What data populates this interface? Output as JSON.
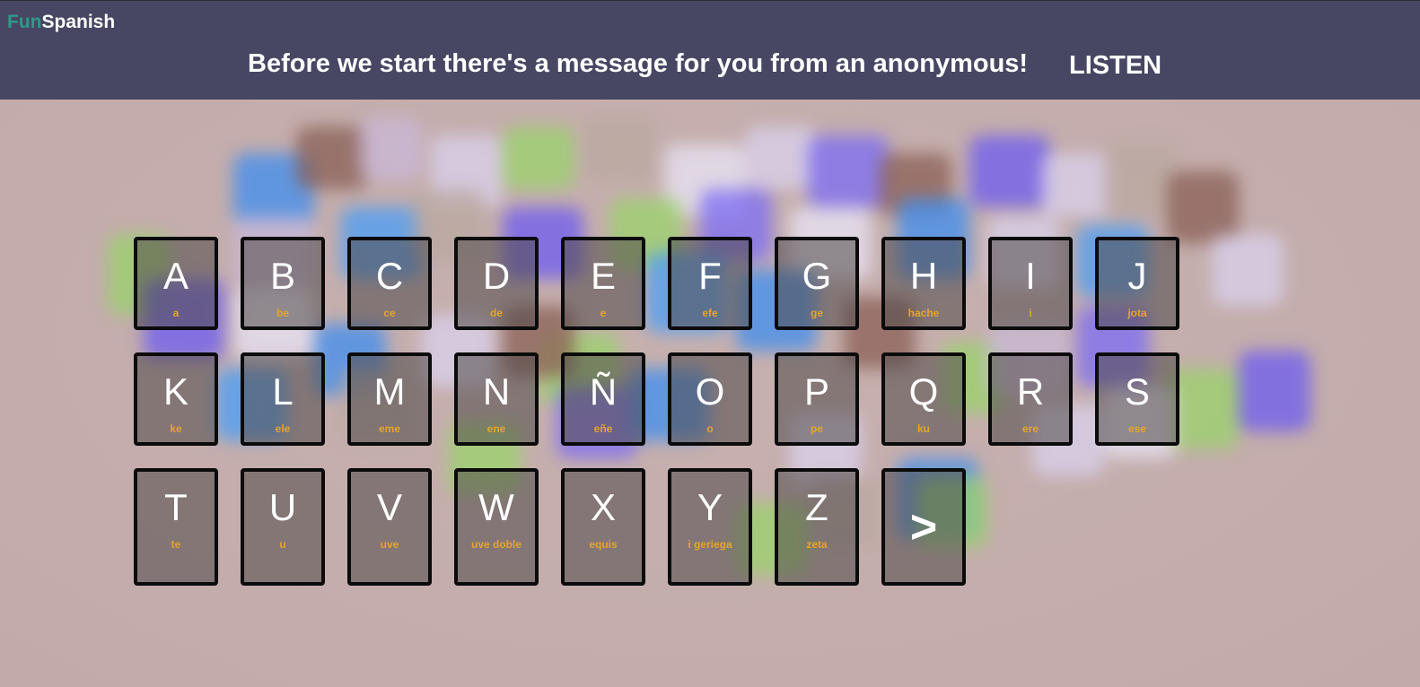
{
  "logo": {
    "part1": "Fun",
    "part2": "Spanish"
  },
  "header": {
    "message": "Before we start there's a message for you from an anonymous!",
    "listen_label": "LISTEN"
  },
  "alphabet": [
    {
      "letter": "A",
      "name": "a"
    },
    {
      "letter": "B",
      "name": "be"
    },
    {
      "letter": "C",
      "name": "ce"
    },
    {
      "letter": "D",
      "name": "de"
    },
    {
      "letter": "E",
      "name": "e"
    },
    {
      "letter": "F",
      "name": "efe"
    },
    {
      "letter": "G",
      "name": "ge"
    },
    {
      "letter": "H",
      "name": "hache"
    },
    {
      "letter": "I",
      "name": "i"
    },
    {
      "letter": "J",
      "name": "jota"
    },
    {
      "letter": "K",
      "name": "ke"
    },
    {
      "letter": "L",
      "name": "ele"
    },
    {
      "letter": "M",
      "name": "eme"
    },
    {
      "letter": "N",
      "name": "ene"
    },
    {
      "letter": "Ñ",
      "name": "eñe"
    },
    {
      "letter": "O",
      "name": "o"
    },
    {
      "letter": "P",
      "name": "pe"
    },
    {
      "letter": "Q",
      "name": "ku"
    },
    {
      "letter": "R",
      "name": "ere"
    },
    {
      "letter": "S",
      "name": "ese"
    },
    {
      "letter": "T",
      "name": "te"
    },
    {
      "letter": "U",
      "name": "u"
    },
    {
      "letter": "V",
      "name": "uve"
    },
    {
      "letter": "W",
      "name": "uve doble"
    },
    {
      "letter": "X",
      "name": "equis"
    },
    {
      "letter": "Y",
      "name": "i geriega"
    },
    {
      "letter": "Z",
      "name": "zeta"
    }
  ],
  "next_button": {
    "label": ">"
  },
  "colors": {
    "header_bg": "#474763",
    "logo_fun": "#2f9a8a",
    "logo_spanish": "#ffffff",
    "tile_border": "#0b0b0b",
    "letter_name": "#e6a52c"
  }
}
